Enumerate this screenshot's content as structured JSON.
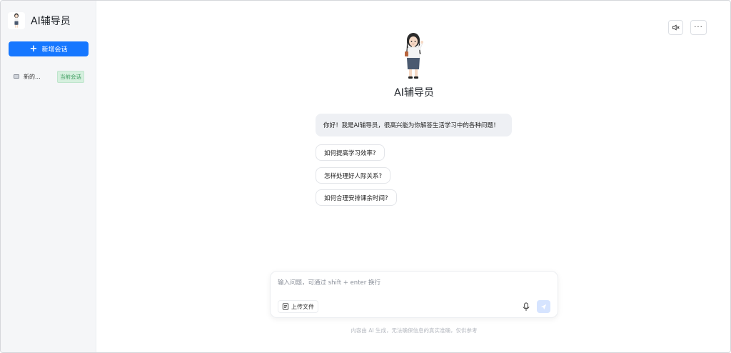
{
  "sidebar": {
    "brand_name": "AI辅导员",
    "new_chat_label": "新增会话",
    "new_chat_icon": "plus-icon",
    "conversations": [
      {
        "label": "新的...",
        "badge": "当前会话",
        "icon": "chat-bubble-icon"
      }
    ]
  },
  "header": {
    "mute_icon": "speaker-muted-icon",
    "more_label": "···"
  },
  "main": {
    "assistant_name": "AI辅导员",
    "greeting": "你好！我是AI辅导员，很高兴能为你解答生活学习中的各种问题！",
    "suggestions": [
      "如何提高学习效率?",
      "怎样处理好人际关系?",
      "如何合理安排课余时间?"
    ]
  },
  "composer": {
    "placeholder": "输入问题，可通过 shift + enter 换行",
    "value": "",
    "upload_label": "上传文件",
    "upload_icon": "file-icon",
    "mic_icon": "microphone-icon",
    "send_icon": "send-icon"
  },
  "disclaimer": "内容由 AI 生成，无法确保信息的真实准确，仅供参考",
  "colors": {
    "accent": "#1677ff",
    "sidebar_bg": "#f5f6f8",
    "badge_bg": "#d6f0df",
    "badge_text": "#3c9b5e",
    "send_disabled": "#d6e4ff"
  }
}
